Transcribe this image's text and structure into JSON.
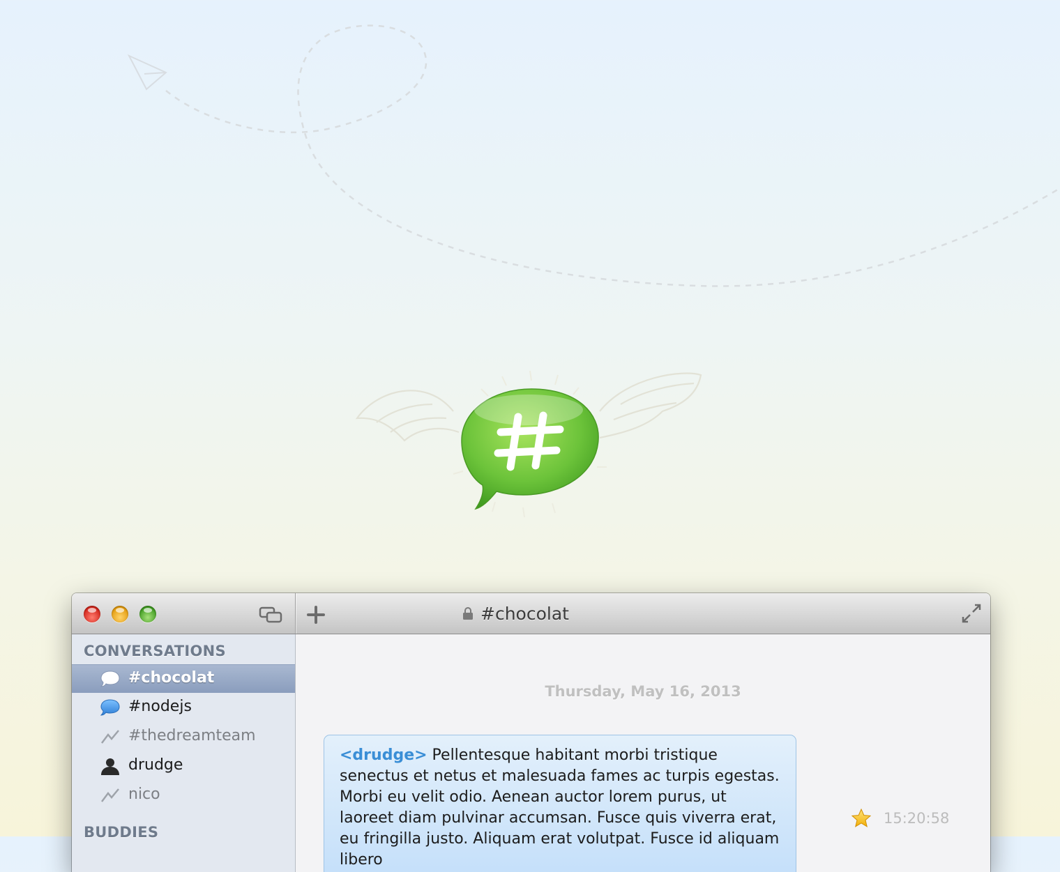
{
  "window": {
    "title": "#chocolat"
  },
  "sidebar": {
    "conversations_header": "CONVERSATIONS",
    "items": [
      {
        "label": "#chocolat",
        "icon": "speech-bubble-icon",
        "state": "selected"
      },
      {
        "label": "#nodejs",
        "icon": "blue-speech-bubble-icon",
        "state": "unread"
      },
      {
        "label": "#thedreamteam",
        "icon": "inactive-zigzag-icon",
        "state": "inactive"
      },
      {
        "label": "drudge",
        "icon": "person-icon",
        "state": "active"
      },
      {
        "label": "nico",
        "icon": "inactive-zigzag-icon",
        "state": "inactive"
      }
    ],
    "buddies_header": "BUDDIES"
  },
  "chat": {
    "date": "Thursday, May 16, 2013",
    "messages": [
      {
        "nick": "<drudge>",
        "text": "Pellentesque habitant morbi tristique senectus et netus et malesuada fames ac turpis egestas. Morbi eu velit odio. Aenean auctor lorem purus, ut laoreet diam pulvinar accumsan. Fusce quis viverra erat, eu fringilla justo. Aliquam erat volutpat. Fusce id aliquam libero",
        "time": "15:20:58",
        "starred": true
      }
    ]
  },
  "colors": {
    "logo_green": "#6cc33a",
    "nick_blue": "#3a8ed6",
    "selection": "#95a6c4",
    "bubble": "#d2e7fb"
  }
}
